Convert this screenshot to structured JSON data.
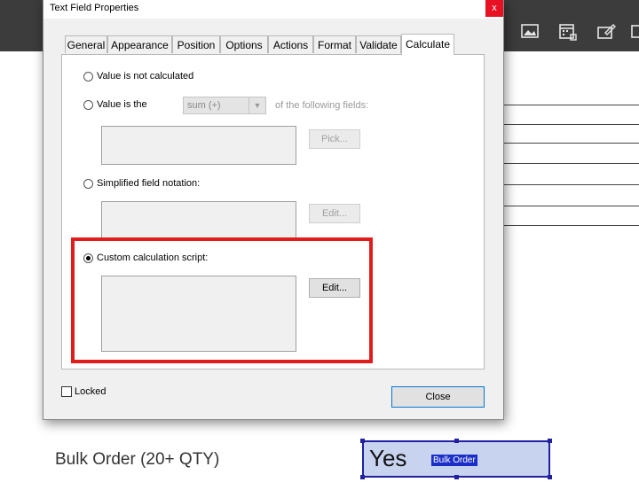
{
  "dialog": {
    "title": "Text Field Properties",
    "close_glyph": "x",
    "tabs": [
      {
        "label": "General"
      },
      {
        "label": "Appearance"
      },
      {
        "label": "Position"
      },
      {
        "label": "Options"
      },
      {
        "label": "Actions"
      },
      {
        "label": "Format"
      },
      {
        "label": "Validate"
      },
      {
        "label": "Calculate",
        "active": true
      }
    ],
    "calculate": {
      "radio_not_calculated": "Value is not calculated",
      "radio_value_is_the": "Value is the",
      "operation_select_value": "sum (+)",
      "following_fields_text": "of the following fields:",
      "pick_button": "Pick...",
      "radio_simplified": "Simplified field notation:",
      "simplified_edit_button": "Edit...",
      "radio_custom": "Custom calculation script:",
      "custom_edit_button": "Edit...",
      "selected_option": "custom"
    },
    "locked_label": "Locked",
    "close_button": "Close"
  },
  "document": {
    "bulk_order_label": "Bulk Order (20+ QTY)",
    "field_value": "Yes",
    "field_name_tag": "Bulk Order"
  },
  "toolbar": {
    "icons": [
      "image-icon",
      "calendar-icon",
      "edit-signature-icon",
      "more-icon"
    ]
  },
  "colors": {
    "highlight_border": "#e21c1c",
    "field_fill": "#c7d3ef",
    "field_border": "#2020a0",
    "toolbar_bg": "#3c3c3c"
  }
}
